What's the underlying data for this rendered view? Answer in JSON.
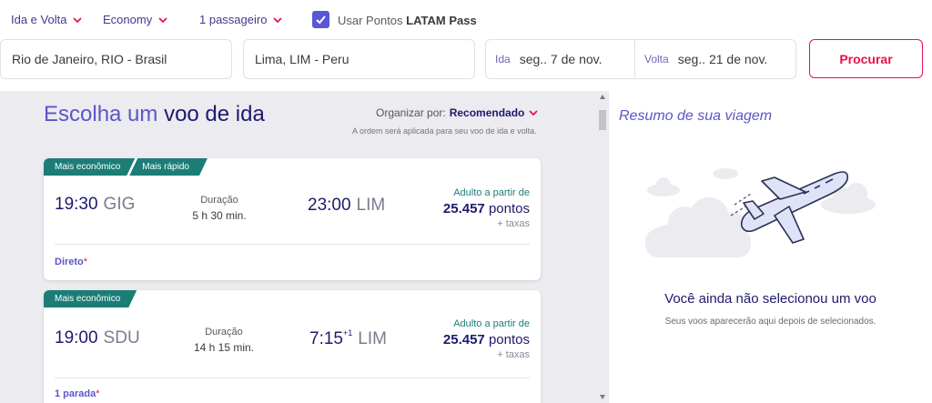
{
  "search": {
    "trip_type": "Ida e Volta",
    "cabin": "Economy",
    "passengers": "1 passageiro",
    "use_points_label": "Usar Pontos",
    "use_points_brand": "LATAM Pass",
    "use_points_checked": true,
    "origin": "Rio de Janeiro, RIO - Brasil",
    "destination": "Lima, LIM - Peru",
    "outbound_label": "Ida",
    "outbound_date": "seg.. 7 de nov.",
    "return_label": "Volta",
    "return_date": "seg.. 21 de nov.",
    "search_button": "Procurar"
  },
  "results": {
    "heading_prefix": "Escolha um",
    "heading_highlight": "voo de ida",
    "sort_label": "Organizar por:",
    "sort_value": "Recomendado",
    "sort_note": "A ordem será aplicada para seu voo de ida e volta.",
    "flights": [
      {
        "tags": [
          "Mais econômico",
          "Mais rápido"
        ],
        "dep_time": "19:30",
        "dep_airport": "GIG",
        "duration_label": "Duração",
        "duration": "5 h 30 min.",
        "arr_time": "23:00",
        "arr_day_offset": "",
        "arr_airport": "LIM",
        "price_label": "Adulto a partir de",
        "price_value": "25.457",
        "price_unit": "pontos",
        "price_taxes": "+ taxas",
        "stops": "Direto",
        "stops_mark": "*"
      },
      {
        "tags": [
          "Mais econômico"
        ],
        "dep_time": "19:00",
        "dep_airport": "SDU",
        "duration_label": "Duração",
        "duration": "14 h 15 min.",
        "arr_time": "7:15",
        "arr_day_offset": "+1",
        "arr_airport": "LIM",
        "price_label": "Adulto a partir de",
        "price_value": "25.457",
        "price_unit": "pontos",
        "price_taxes": "+ taxas",
        "stops": "1 parada",
        "stops_mark": "*"
      }
    ]
  },
  "summary": {
    "title": "Resumo de sua viagem",
    "empty_title": "Você ainda não selecionou um voo",
    "empty_subtitle": "Seus voos aparecerão aqui depois de selecionados.",
    "illustration": "airplane-clouds-illustration"
  },
  "colors": {
    "brand_indigo": "#1e1a6e",
    "accent_purple": "#5c56c6",
    "cta_red": "#e8114b",
    "tag_teal": "#1b7d76"
  }
}
